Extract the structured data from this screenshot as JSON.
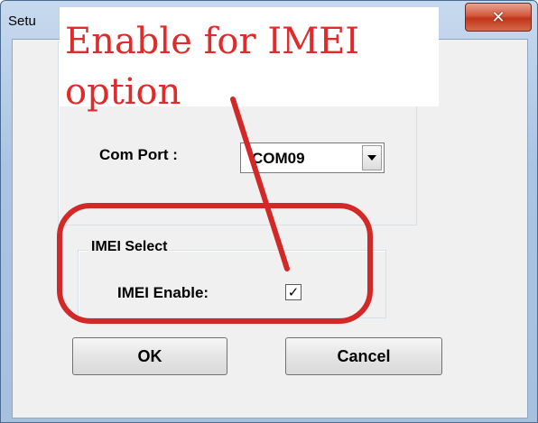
{
  "window": {
    "title": "Setu",
    "close_glyph": "✕"
  },
  "com_port": {
    "label": "Com Port :",
    "selected_value": "COM09"
  },
  "imei_group": {
    "legend": "IMEI Select",
    "enable_label": "IMEI Enable:",
    "enable_checked": true,
    "check_glyph": "✓"
  },
  "buttons": {
    "ok_label": "OK",
    "cancel_label": "Cancel"
  },
  "annotation": {
    "line1": "Enable for IMEI",
    "line2": "option",
    "color": "#e12a2a"
  }
}
